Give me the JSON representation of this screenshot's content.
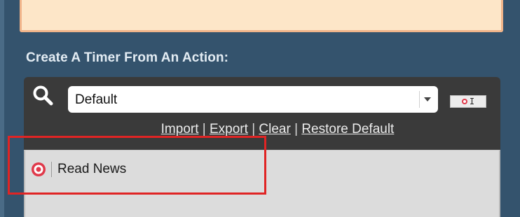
{
  "section": {
    "heading": "Create A Timer From An Action:"
  },
  "search": {
    "selected_value": "Default"
  },
  "links": {
    "import": "Import",
    "export": "Export",
    "clear": "Clear",
    "restore_default": "Restore Default",
    "separator": "|"
  },
  "list": {
    "items": [
      {
        "label": "Read News",
        "icon": "target-icon"
      }
    ]
  },
  "colors": {
    "background": "#34536d",
    "peach_panel": "#fde6c8",
    "toolbar": "#3a3a3a",
    "list_panel": "#dcdcdc",
    "highlight": "#e02424",
    "target_red": "#e0394a"
  }
}
